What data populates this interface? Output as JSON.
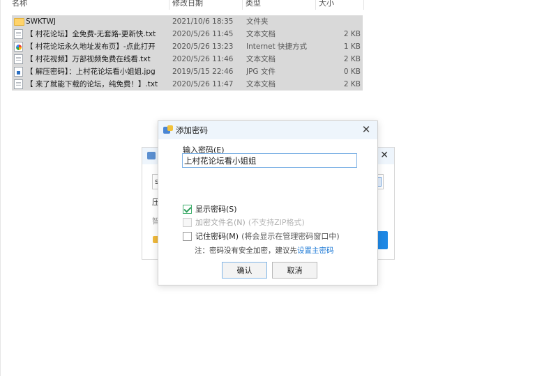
{
  "file_list": {
    "columns": {
      "name": "名称",
      "date": "修改日期",
      "type": "类型",
      "size": "大小"
    },
    "rows": [
      {
        "icon": "folder-icon",
        "name": "SWKTWJ",
        "date": "2021/10/6 18:35",
        "type": "文件夹",
        "size": ""
      },
      {
        "icon": "text-file-icon",
        "name": "【 村花论坛】全免费-无套路-更新快.txt",
        "date": "2020/5/26 11:45",
        "type": "文本文档",
        "size": "2 KB"
      },
      {
        "icon": "internet-shortcut-icon",
        "name": "【 村花论坛永久地址发布页】-点此打开",
        "date": "2020/5/26 13:23",
        "type": "Internet 快捷方式",
        "size": "1 KB"
      },
      {
        "icon": "text-file-icon",
        "name": "【 村花视频】万部视频免费在线看.txt",
        "date": "2020/5/26 11:46",
        "type": "文本文档",
        "size": "2 KB"
      },
      {
        "icon": "image-file-icon",
        "name": "【 解压密码】：上村花论坛看小姐姐.jpg",
        "date": "2019/5/15 22:46",
        "type": "JPG 文件",
        "size": "0 KB"
      },
      {
        "icon": "text-file-icon",
        "name": "【 来了就能下载的论坛，纯免费！】.txt",
        "date": "2020/5/26 11:47",
        "type": "文本文档",
        "size": "2 KB"
      }
    ]
  },
  "background_dialog": {
    "input_char": "s",
    "row1_char": "压",
    "row2_char": "智"
  },
  "dialog": {
    "title": "添加密码",
    "password_label": "输入密码(E)",
    "password_value": "上村花论坛看小姐姐",
    "options": [
      {
        "label": "显示密码(S)",
        "note": "",
        "checked": true,
        "enabled": true
      },
      {
        "label": "加密文件名(N)",
        "note": "(不支持ZIP格式)",
        "checked": false,
        "enabled": false
      },
      {
        "label": "记住密码(M)",
        "note": "(将会显示在管理密码窗口中)",
        "checked": false,
        "enabled": true
      }
    ],
    "note_text": "注：密码没有安全加密，建议先",
    "note_link": "设置主密码",
    "ok_label": "确认",
    "cancel_label": "取消"
  },
  "colors": {
    "accent": "#1e7ad6",
    "selection": "#d9d9d9",
    "title_bar": "#eef5fc",
    "check": "#2e9e5b"
  }
}
